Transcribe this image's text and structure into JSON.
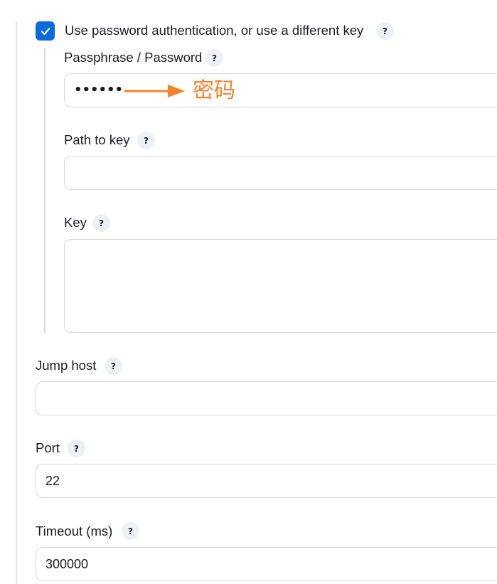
{
  "auth": {
    "checkbox_label": "Use password authentication, or use a different key",
    "checked": true,
    "help": "?",
    "passphrase": {
      "label": "Passphrase / Password",
      "help": "?",
      "value_masked": "••••••",
      "annotation": "密码",
      "annotation_color": "#f5822a"
    },
    "path_to_key": {
      "label": "Path to key",
      "help": "?",
      "value": ""
    },
    "key": {
      "label": "Key",
      "help": "?",
      "value": ""
    }
  },
  "jump_host": {
    "label": "Jump host",
    "help": "?",
    "value": ""
  },
  "port": {
    "label": "Port",
    "help": "?",
    "value": "22"
  },
  "timeout": {
    "label": "Timeout (ms)",
    "help": "?",
    "value": "300000"
  },
  "colors": {
    "checkbox": "#0b6bdc",
    "annotation": "#f5822a",
    "border": "#d3d7de"
  },
  "icons": {
    "checkbox": "checkmark-icon",
    "help": "question-mark-icon",
    "annotation": "arrow-right-icon"
  }
}
